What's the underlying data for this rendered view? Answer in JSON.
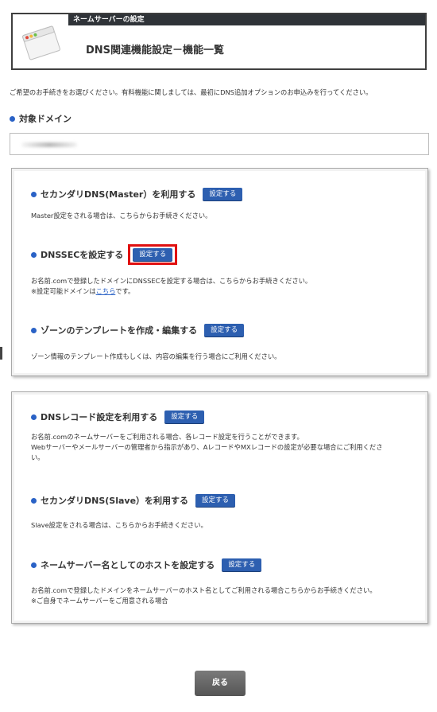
{
  "header": {
    "label": "ネームサーバーの設定",
    "title": "DNS関連機能設定－機能一覧"
  },
  "intro": "ご希望のお手続きをお選びください。有料機能に関しましては、最初にDNS追加オプションのお申込みを行ってください。",
  "domain": {
    "heading": "対象ドメイン",
    "value": ""
  },
  "panel1": {
    "master": {
      "title": "セカンダリDNS(Master）を利用する",
      "button": "設定する",
      "desc": "Master設定をされる場合は、こちらからお手続きください。"
    },
    "dnssec": {
      "title": "DNSSECを設定する",
      "button": "設定する",
      "desc1": "お名前.comで登録したドメインにDNSSECを設定する場合は、こちらからお手続きください。",
      "desc2_pre": "※設定可能ドメインは",
      "desc2_link": "こちら",
      "desc2_post": "です。"
    },
    "zone": {
      "title": "ゾーンのテンプレートを作成・編集する",
      "button": "設定する",
      "desc": "ゾーン情報のテンプレート作成もしくは、内容の編集を行う場合にご利用ください。"
    }
  },
  "panel2": {
    "record": {
      "title": "DNSレコード設定を利用する",
      "button": "設定する",
      "desc1": "お名前.comのネームサーバーをご利用される場合、各レコード設定を行うことができます。",
      "desc2": "Webサーバーやメールサーバーの管理者から指示があり、AレコードやMXレコードの設定が必要な場合にご利用くださ",
      "desc3": "い。"
    },
    "slave": {
      "title": "セカンダリDNS(Slave）を利用する",
      "button": "設定する",
      "desc": "Slave設定をされる場合は、こちらからお手続きください。"
    },
    "host": {
      "title": "ネームサーバー名としてのホストを設定する",
      "button": "設定する",
      "desc1": "お名前.comで登録したドメインをネームサーバーのホスト名としてご利用される場合こちらからお手続きください。",
      "desc2": "※ご自身でネームサーバーをご用意される場合"
    }
  },
  "back_button": "戻る",
  "colors": {
    "accent_blue": "#2d5fb0",
    "highlight_red": "#e01010",
    "header_dark": "#2f3338"
  }
}
